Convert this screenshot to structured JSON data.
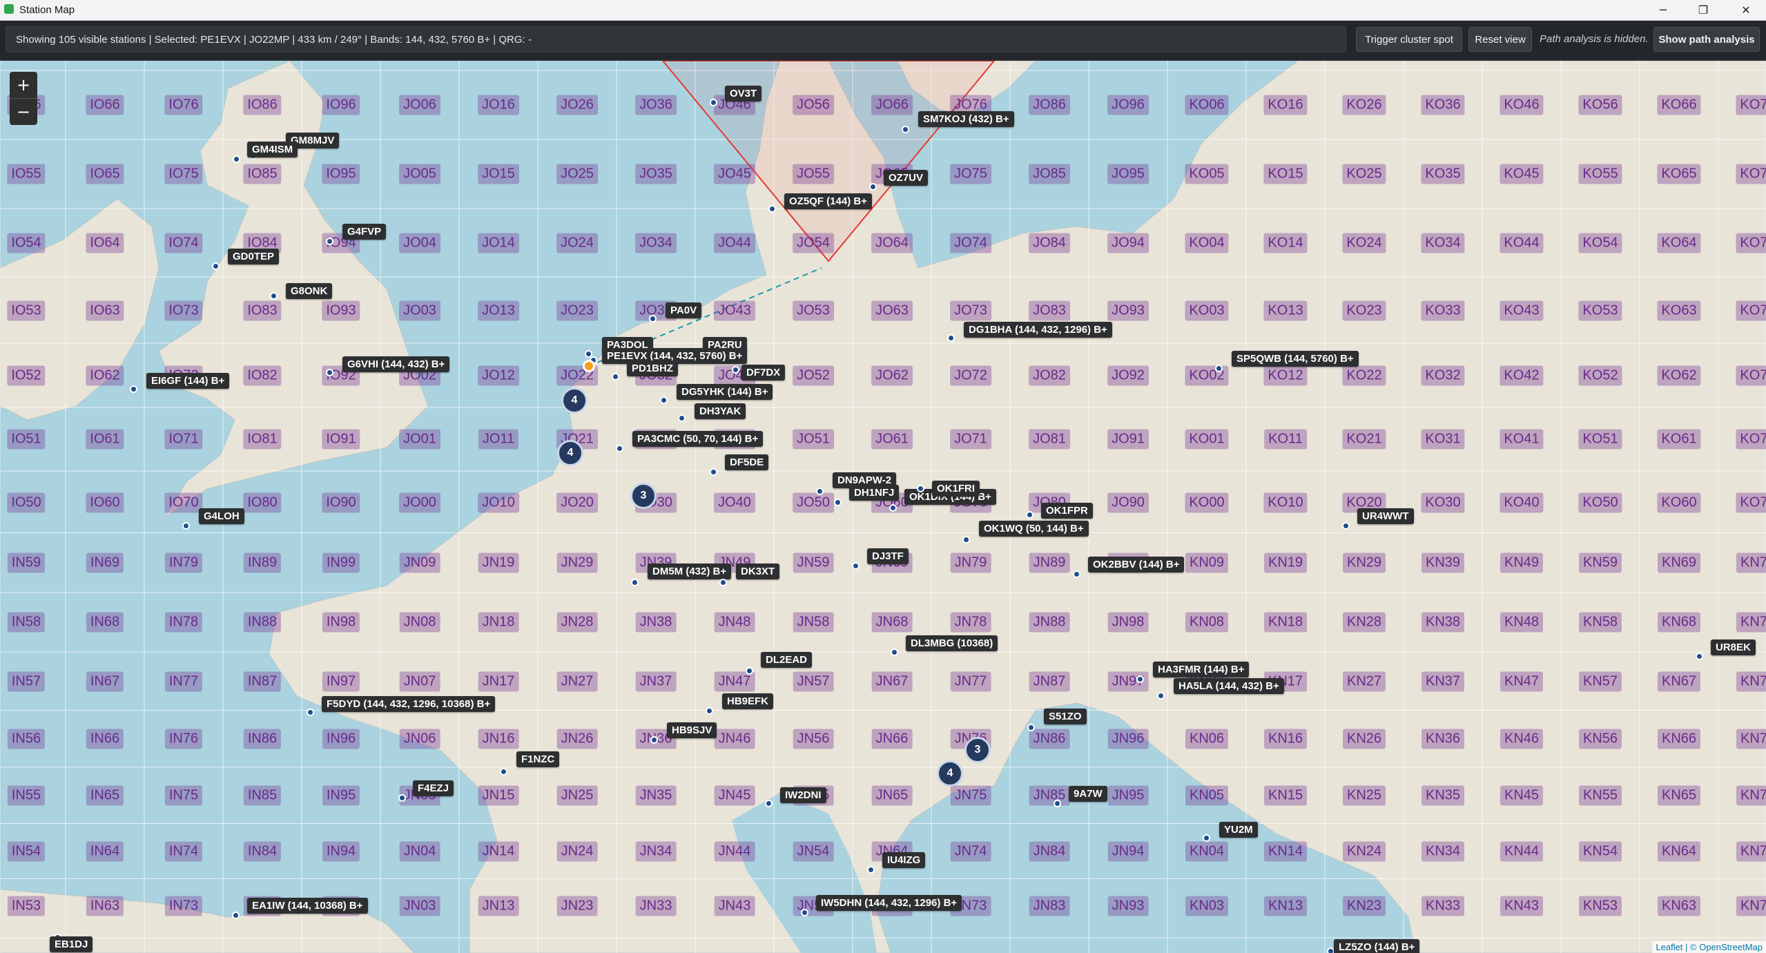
{
  "window": {
    "title": "Station Map",
    "minimize_glyph": "─",
    "maximize_glyph": "❐",
    "close_glyph": "✕"
  },
  "toolbar": {
    "status": "Showing 105 visible stations | Selected: PE1EVX | JO22MP | 433 km / 249° | Bands: 144, 432, 5760 B+ | QRG: -",
    "trigger_label": "Trigger cluster spot",
    "reset_label": "Reset view",
    "path_note": "Path analysis is hidden.",
    "show_path_label": "Show path analysis"
  },
  "map": {
    "zoom_in": "+",
    "zoom_out": "−",
    "attribution": "Leaflet | © OpenStreetMap",
    "colors": {
      "sea": "#aad3df",
      "land": "#e9e4d8",
      "grid": "#ffffff",
      "locator_text": "#6a2a8a",
      "station_marker": "#1f4c8c",
      "selected_marker": "#f0a21e",
      "beam": "#e53935",
      "path": "#1a9ba8"
    },
    "locator_labels": [
      [
        "IO56",
        "IO66",
        "IO76",
        "IO86",
        "IO96",
        "JO06",
        "JO16",
        "JO26",
        "JO36",
        "JO46",
        "JO56",
        "JO66",
        "JO76",
        "JO86",
        "JO96",
        "KO06",
        "KO16",
        "KO26",
        "KO36",
        "KO46",
        "KO56",
        "KO66",
        "KO76"
      ],
      [
        "IO55",
        "IO65",
        "IO75",
        "IO85",
        "IO95",
        "JO05",
        "JO15",
        "JO25",
        "JO35",
        "JO45",
        "JO55",
        "JO65",
        "JO75",
        "JO85",
        "JO95",
        "KO05",
        "KO15",
        "KO25",
        "KO35",
        "KO45",
        "KO55",
        "KO65",
        "KO75"
      ],
      [
        "IO54",
        "IO64",
        "IO74",
        "IO84",
        "IO94",
        "JO04",
        "JO14",
        "JO24",
        "JO34",
        "JO44",
        "JO54",
        "JO64",
        "JO74",
        "JO84",
        "JO94",
        "KO04",
        "KO14",
        "KO24",
        "KO34",
        "KO44",
        "KO54",
        "KO64",
        "KO74"
      ],
      [
        "IO53",
        "IO63",
        "IO73",
        "IO83",
        "IO93",
        "JO03",
        "JO13",
        "JO23",
        "JO33",
        "JO43",
        "JO53",
        "JO63",
        "JO73",
        "JO83",
        "JO93",
        "KO03",
        "KO13",
        "KO23",
        "KO33",
        "KO43",
        "KO53",
        "KO63",
        "KO73"
      ],
      [
        "IO52",
        "IO62",
        "IO72",
        "IO82",
        "IO92",
        "JO02",
        "JO12",
        "JO22",
        "JO32",
        "JO42",
        "JO52",
        "JO62",
        "JO72",
        "JO82",
        "JO92",
        "KO02",
        "KO12",
        "KO22",
        "KO32",
        "KO42",
        "KO52",
        "KO62",
        "KO72"
      ],
      [
        "IO51",
        "IO61",
        "IO71",
        "IO81",
        "IO91",
        "JO01",
        "JO11",
        "JO21",
        "JO31",
        "JO41",
        "JO51",
        "JO61",
        "JO71",
        "JO81",
        "JO91",
        "KO01",
        "KO11",
        "KO21",
        "KO31",
        "KO41",
        "KO51",
        "KO61",
        "KO71"
      ],
      [
        "IO50",
        "IO60",
        "IO70",
        "IO80",
        "IO90",
        "JO00",
        "JO10",
        "JO20",
        "JO30",
        "JO40",
        "JO50",
        "JO60",
        "JO70",
        "JO80",
        "JO90",
        "KO00",
        "KO10",
        "KO20",
        "KO30",
        "KO40",
        "KO50",
        "KO60",
        "KO70"
      ],
      [
        "IN59",
        "IN69",
        "IN79",
        "IN89",
        "IN99",
        "JN09",
        "JN19",
        "JN29",
        "JN39",
        "JN49",
        "JN59",
        "JN69",
        "JN79",
        "JN89",
        "JN99",
        "KN09",
        "KN19",
        "KN29",
        "KN39",
        "KN49",
        "KN59",
        "KN69",
        "KN79"
      ],
      [
        "IN58",
        "IN68",
        "IN78",
        "IN88",
        "IN98",
        "JN08",
        "JN18",
        "JN28",
        "JN38",
        "JN48",
        "JN58",
        "JN68",
        "JN78",
        "JN88",
        "JN98",
        "KN08",
        "KN18",
        "KN28",
        "KN38",
        "KN48",
        "KN58",
        "KN68",
        "KN78"
      ],
      [
        "IN57",
        "IN67",
        "IN77",
        "IN87",
        "IN97",
        "JN07",
        "JN17",
        "JN27",
        "JN37",
        "JN47",
        "JN57",
        "JN67",
        "JN77",
        "JN87",
        "JN97",
        "KN07",
        "KN17",
        "KN27",
        "KN37",
        "KN47",
        "KN57",
        "KN67",
        "KN77"
      ],
      [
        "IN56",
        "IN66",
        "IN76",
        "IN86",
        "IN96",
        "JN06",
        "JN16",
        "JN26",
        "JN36",
        "JN46",
        "JN56",
        "JN66",
        "JN76",
        "JN86",
        "JN96",
        "KN06",
        "KN16",
        "KN26",
        "KN36",
        "KN46",
        "KN56",
        "KN66",
        "KN76"
      ],
      [
        "IN55",
        "IN65",
        "IN75",
        "IN85",
        "IN95",
        "JN05",
        "JN15",
        "JN25",
        "JN35",
        "JN45",
        "JN55",
        "JN65",
        "JN75",
        "JN85",
        "JN95",
        "KN05",
        "KN15",
        "KN25",
        "KN35",
        "KN45",
        "KN55",
        "KN65",
        "KN75"
      ],
      [
        "IN54",
        "IN64",
        "IN74",
        "IN84",
        "IN94",
        "JN04",
        "JN14",
        "JN24",
        "JN34",
        "JN44",
        "JN54",
        "JN64",
        "JN74",
        "JN84",
        "JN94",
        "KN04",
        "KN14",
        "KN24",
        "KN34",
        "KN44",
        "KN54",
        "KN64",
        "KN74"
      ],
      [
        "IN53",
        "IN63",
        "IN73",
        "IN83",
        "IN93",
        "JN03",
        "JN13",
        "JN23",
        "JN33",
        "JN43",
        "JN53",
        "JN63",
        "JN73",
        "JN83",
        "JN93",
        "KN03",
        "KN13",
        "KN23",
        "KN33",
        "KN43",
        "KN53",
        "KN63",
        "KN73"
      ]
    ],
    "stations": [
      "OV3T",
      "SM7KOJ (432) B+",
      "OZ7UV",
      "OZ5QF (144) B+",
      "GM8MJV",
      "GM4ISM",
      "G4FVP",
      "GD0TEP",
      "G8ONK",
      "PA0V",
      "DG1BHA (144, 432, 1296) B+",
      "PA3DOL",
      "PA2RU",
      "PE1EVX (144, 432, 5760) B+",
      "PD1BHZ",
      "DF7DX",
      "G6VHI (144, 432) B+",
      "EI6GF (144) B+",
      "SP5QWB (144, 5760) B+",
      "DG5YHK (144) B+",
      "DH3YAK",
      "PA3CMC (50, 70, 144) B+",
      "DF5DE",
      "DN9APW-2",
      "DH1NFJ",
      "OK1DIX (144) B+",
      "OK1FRI",
      "OK1FPR",
      "OK1WQ (50, 144) B+",
      "UR4WWT",
      "G4LOH",
      "DJ3TF",
      "OK2BBV (144) B+",
      "DM5M (432) B+",
      "DK3XT",
      "DL3MBG (10368)",
      "UR8EK",
      "DL2EAD",
      "HA3FMR (144) B+",
      "HA5LA (144, 432) B+",
      "F5DYD (144, 432, 1296, 10368) B+",
      "HB9EFK",
      "S51ZO",
      "HB9SJV",
      "F1NZC",
      "F4EZJ",
      "IW2DNI",
      "9A7W",
      "YU2M",
      "IU4IZG",
      "EA1IW (144, 10368) B+",
      "IW5DHN (144, 432, 1296) B+",
      "EB1DJ",
      "LZ5ZO (144) B+"
    ],
    "clusters": [
      "4",
      "4",
      "3",
      "3",
      "4"
    ]
  }
}
